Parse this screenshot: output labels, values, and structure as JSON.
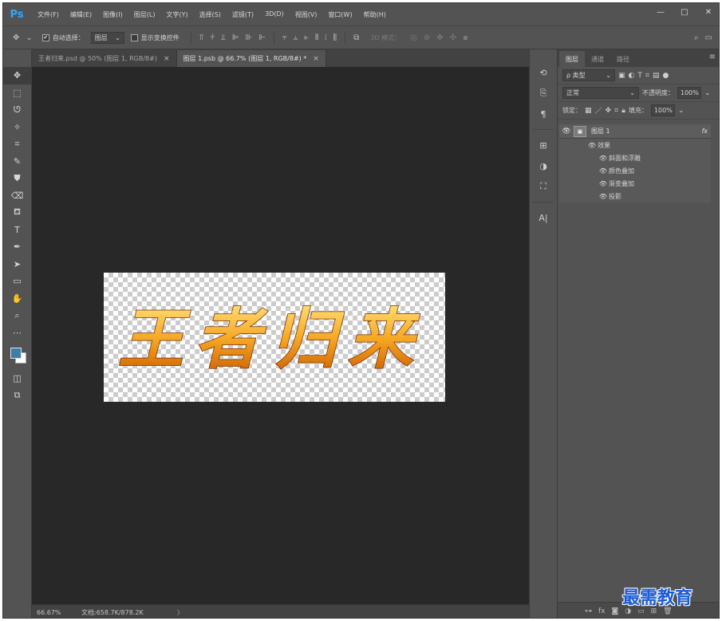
{
  "app": {
    "logo": "Ps",
    "menu": [
      "文件(F)",
      "编辑(E)",
      "图像(I)",
      "图层(L)",
      "文字(Y)",
      "选择(S)",
      "滤镜(T)",
      "3D(D)",
      "视图(V)",
      "窗口(W)",
      "帮助(H)"
    ],
    "window_controls": [
      "—",
      "□",
      "✕"
    ]
  },
  "options_bar": {
    "auto_select_label": "自动选择：",
    "auto_select_checked": "✔",
    "auto_select_target": "图层",
    "show_transform_label": "显示变换控件",
    "mode_3d_label": "3D 模式："
  },
  "tabs": [
    {
      "label": "王者归来.psd @ 50% (图层 1, RGB/8#)",
      "close": "×"
    },
    {
      "label": "图层 1.psb @ 66.7% (图层 1, RGB/8#) *",
      "close": "×"
    }
  ],
  "status": {
    "zoom": "66.67%",
    "doc_info": "文档:658.7K/878.2K",
    "arrow": "〉"
  },
  "layers_panel": {
    "tabs": [
      "图层",
      "通道",
      "路径"
    ],
    "menu_icon": "≡",
    "filter_kind": "ρ 类型",
    "blend_mode": "正常",
    "opacity_label": "不透明度：",
    "opacity_value": "100%",
    "lock_label": "锁定：",
    "fill_label": "填充：",
    "fill_value": "100%",
    "layer": {
      "name": "图层 1",
      "fx": "fx"
    },
    "effects_label": "效果",
    "effects": [
      "斜面和浮雕",
      "颜色叠加",
      "渐变叠加",
      "投影"
    ]
  },
  "canvas": {
    "artwork_text": "王者归来",
    "colors": {
      "gold_light": "#ffe27a",
      "gold_mid": "#f5a623",
      "gold_dark": "#c85a00",
      "workspace": "#282828"
    }
  },
  "watermark": "最需教育"
}
